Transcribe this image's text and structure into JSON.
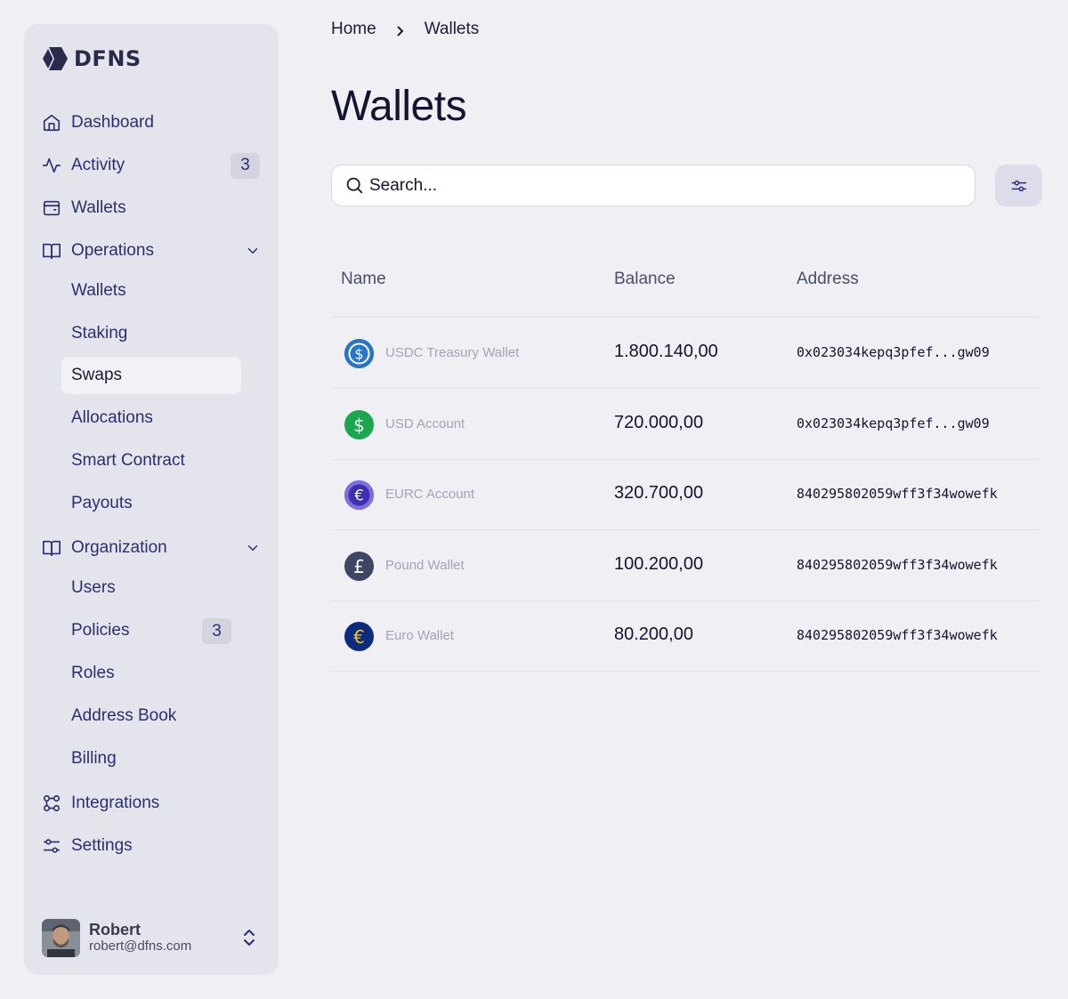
{
  "brand": {
    "name": "DFNS"
  },
  "sidebar": {
    "nav": [
      {
        "label": "Dashboard",
        "icon": "home-icon"
      },
      {
        "label": "Activity",
        "icon": "activity-icon",
        "badge": "3"
      },
      {
        "label": "Wallets",
        "icon": "wallet-icon"
      },
      {
        "label": "Operations",
        "icon": "book-icon"
      },
      {
        "label": "Organization",
        "icon": "book-icon"
      },
      {
        "label": "Integrations",
        "icon": "integrations-icon"
      },
      {
        "label": "Settings",
        "icon": "sliders-icon"
      }
    ],
    "operations_items": [
      {
        "label": "Wallets"
      },
      {
        "label": "Staking"
      },
      {
        "label": "Swaps",
        "active": true
      },
      {
        "label": "Allocations"
      },
      {
        "label": "Smart Contract"
      },
      {
        "label": "Payouts"
      }
    ],
    "organization_items": [
      {
        "label": "Users"
      },
      {
        "label": "Policies",
        "badge": "3"
      },
      {
        "label": "Roles"
      },
      {
        "label": "Address Book"
      },
      {
        "label": "Billing"
      }
    ],
    "user": {
      "name": "Robert",
      "email": "robert@dfns.com"
    }
  },
  "breadcrumb": {
    "home": "Home",
    "current": "Wallets"
  },
  "page": {
    "title": "Wallets"
  },
  "search": {
    "placeholder": "Search..."
  },
  "table": {
    "columns": [
      "Name",
      "Balance",
      "Address"
    ],
    "rows": [
      {
        "name": "USDC Treasury Wallet",
        "balance": "1.800.140,00",
        "address": "0x023034kepq3pfef...gw09",
        "icon": "usdc-coin-icon",
        "color": "#2775ca"
      },
      {
        "name": "USD Account",
        "balance": "720.000,00",
        "address": "0x023034kepq3pfef...gw09",
        "icon": "dollar-coin-icon",
        "color": "#1aa74f"
      },
      {
        "name": "EURC Account",
        "balance": "320.700,00",
        "address": "840295802059wff3f34wowefk",
        "icon": "eurc-coin-icon",
        "color": "#5a4bd1"
      },
      {
        "name": "Pound  Wallet",
        "balance": "100.200,00",
        "address": "840295802059wff3f34wowefk",
        "icon": "pound-coin-icon",
        "color": "#3d4663"
      },
      {
        "name": "Euro  Wallet",
        "balance": "80.200,00",
        "address": "840295802059wff3f34wowefk",
        "icon": "euro-coin-icon",
        "color": "#0c2a80"
      }
    ]
  },
  "colors": {
    "sidebar_bg": "#e4e4ec",
    "nav_text": "#2b2f70",
    "page_bg": "#f0f0f4"
  }
}
